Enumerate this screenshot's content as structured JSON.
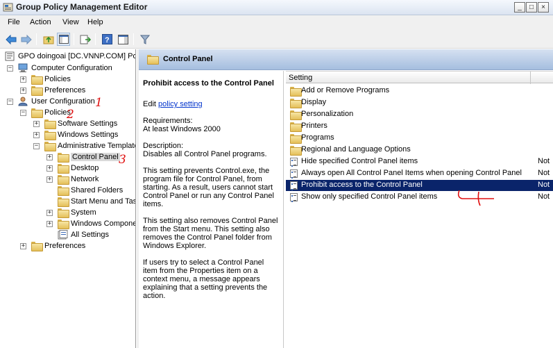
{
  "window": {
    "title": "Group Policy Management Editor",
    "buttons": {
      "minimize": "_",
      "maximize": "□",
      "close": "×"
    }
  },
  "menubar": [
    "File",
    "Action",
    "View",
    "Help"
  ],
  "tree": {
    "root": "GPO doingoai [DC.VNNP.COM] Policy",
    "computer_configuration": "Computer Configuration",
    "cc_policies": "Policies",
    "cc_preferences": "Preferences",
    "user_configuration": "User Configuration",
    "uc_policies": "Policies",
    "software_settings": "Software Settings",
    "windows_settings": "Windows Settings",
    "administrative_templates": "Administrative Templates",
    "control_panel": "Control Panel",
    "desktop": "Desktop",
    "network": "Network",
    "shared_folders": "Shared Folders",
    "start_menu": "Start Menu and Taskbar",
    "system": "System",
    "windows_components": "Windows Components",
    "all_settings": "All Settings",
    "uc_preferences": "Preferences"
  },
  "annotations": {
    "a1": "1",
    "a2": "2",
    "a3": "3",
    "a4": "4"
  },
  "content": {
    "header": "Control Panel",
    "description": {
      "heading": "Prohibit access to the Control Panel",
      "edit_prefix": "Edit",
      "edit_link": "policy setting",
      "requirements_label": "Requirements:",
      "requirements_value": "At least Windows 2000",
      "description_label": "Description:",
      "description_value": "Disables all Control Panel programs.",
      "p1": "This setting prevents Control.exe, the program file for Control Panel, from starting. As a result, users cannot start Control Panel or run any Control Panel items.",
      "p2": "This setting also removes Control Panel from the Start menu. This setting also removes the Control Panel folder from Windows Explorer.",
      "p3": "If users try to select a Control Panel item from the Properties item on a context menu, a message appears explaining that a setting prevents the action."
    },
    "list": {
      "column_setting": "Setting",
      "rows": [
        {
          "label": "Add or Remove Programs",
          "type": "folder",
          "state": ""
        },
        {
          "label": "Display",
          "type": "folder",
          "state": ""
        },
        {
          "label": "Personalization",
          "type": "folder",
          "state": ""
        },
        {
          "label": "Printers",
          "type": "folder",
          "state": ""
        },
        {
          "label": "Programs",
          "type": "folder",
          "state": ""
        },
        {
          "label": "Regional and Language Options",
          "type": "folder",
          "state": ""
        },
        {
          "label": "Hide specified Control Panel items",
          "type": "policy",
          "state": "Not"
        },
        {
          "label": "Always open All Control Panel Items when opening Control Panel",
          "type": "policy",
          "state": "Not"
        },
        {
          "label": "Prohibit access to the Control Panel",
          "type": "policy",
          "state": "Not"
        },
        {
          "label": "Show only specified Control Panel items",
          "type": "policy",
          "state": "Not"
        }
      ]
    }
  },
  "colors": {
    "selection": "#0a246a",
    "link": "#0033cc",
    "annotation": "#e01010"
  }
}
